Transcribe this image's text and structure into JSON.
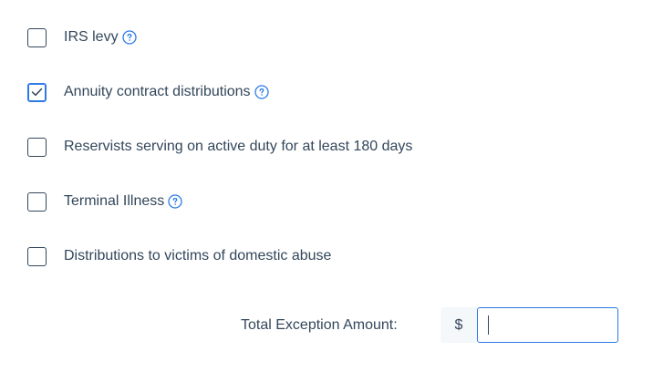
{
  "options": [
    {
      "label": "IRS levy",
      "checked": false,
      "has_help": true
    },
    {
      "label": "Annuity contract distributions",
      "checked": true,
      "has_help": true
    },
    {
      "label": "Reservists serving on active duty for at least 180 days",
      "checked": false,
      "has_help": false
    },
    {
      "label": "Terminal Illness",
      "checked": false,
      "has_help": true
    },
    {
      "label": "Distributions to victims of domestic abuse",
      "checked": false,
      "has_help": false
    }
  ],
  "total": {
    "label": "Total Exception Amount:",
    "currency_symbol": "$",
    "value": "",
    "placeholder": ""
  },
  "colors": {
    "text": "#33475b",
    "accent": "#2c7be5",
    "addon_bg": "#f5f8fa"
  },
  "icons": {
    "help": "question-circle-icon",
    "check": "checkmark-icon"
  }
}
